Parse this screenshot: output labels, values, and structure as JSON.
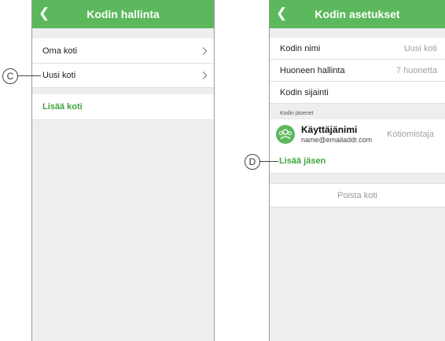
{
  "left_screen": {
    "header": {
      "back_icon": "chevron-left",
      "title": "Kodin hallinta"
    },
    "homes": [
      {
        "label": "Oma koti"
      },
      {
        "label": "Uusi koti"
      }
    ],
    "add_home_label": "Lisää koti"
  },
  "right_screen": {
    "header": {
      "back_icon": "chevron-left",
      "title": "Kodin asetukset"
    },
    "settings": [
      {
        "label": "Kodin nimi",
        "value": "Uusi koti"
      },
      {
        "label": "Huoneen hallinta",
        "value": "7 huonetta"
      },
      {
        "label": "Kodin sijainti",
        "value": ""
      }
    ],
    "members_section_label": "Kodin jäsenet",
    "member": {
      "name": "Käyttäjänimi",
      "email": "name@emailaddr.com",
      "role": "Kotiomistaja"
    },
    "add_member_label": "Lisää jäsen",
    "delete_home_label": "Poista koti"
  },
  "callouts": {
    "c": "C",
    "d": "D"
  },
  "colors": {
    "header": "#5cb85c",
    "accent_text": "#3fa53f",
    "background": "#eeeeee"
  }
}
